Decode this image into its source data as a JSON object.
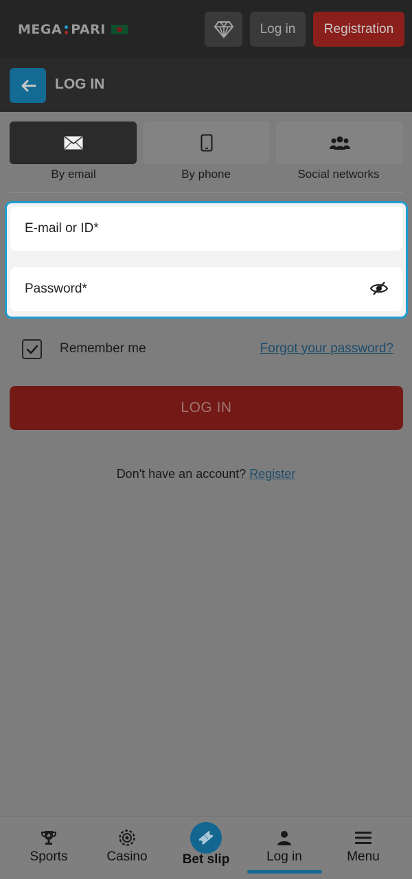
{
  "header": {
    "logo_left": "MEGA",
    "logo_right": "PARI",
    "login_label": "Log in",
    "register_label": "Registration"
  },
  "titlebar": {
    "title": "LOG IN"
  },
  "tabs": [
    {
      "label": "By email",
      "icon": "envelope-icon",
      "active": true
    },
    {
      "label": "By phone",
      "icon": "phone-icon",
      "active": false
    },
    {
      "label": "Social networks",
      "icon": "users-icon",
      "active": false
    }
  ],
  "form": {
    "email_placeholder": "E-mail or ID*",
    "password_placeholder": "Password*",
    "remember_label": "Remember me",
    "remember_checked": true,
    "forgot_label": "Forgot your password?",
    "submit_label": "LOG IN"
  },
  "signup": {
    "prompt": "Don't have an account?",
    "link": "Register"
  },
  "bottom_nav": [
    {
      "label": "Sports",
      "icon": "trophy-icon"
    },
    {
      "label": "Casino",
      "icon": "chip-icon"
    },
    {
      "label": "Bet slip",
      "icon": "ticket-icon"
    },
    {
      "label": "Log in",
      "icon": "user-icon",
      "active": true
    },
    {
      "label": "Menu",
      "icon": "hamburger-icon"
    }
  ],
  "colors": {
    "accent": "#1f9bd1",
    "brand_red": "#8a1f1b",
    "link": "#1d4d6c"
  }
}
